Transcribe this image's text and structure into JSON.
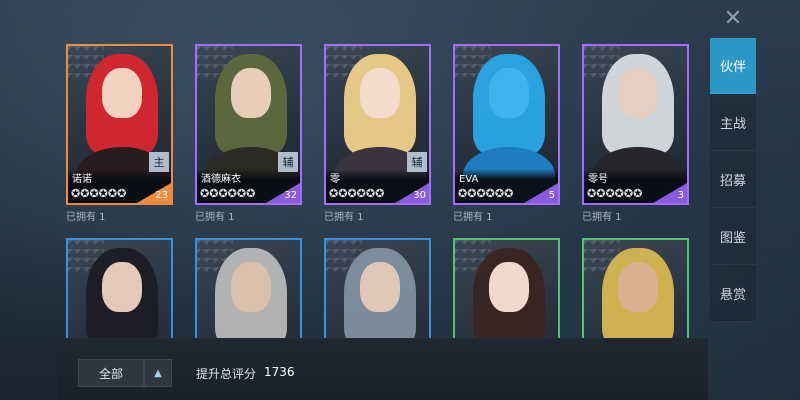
{
  "close_icon": "✕",
  "menu": [
    {
      "label": "伙伴",
      "active": true
    },
    {
      "label": "主战",
      "active": false
    },
    {
      "label": "招募",
      "active": false
    },
    {
      "label": "图鉴",
      "active": false
    },
    {
      "label": "悬赏",
      "active": false
    }
  ],
  "cards": [
    {
      "name": "诺诺",
      "level": "23",
      "role": "主",
      "owned": "已拥有  1",
      "stars": 6,
      "frame": "orange",
      "hair": "#d8262e",
      "skin": "#f3d2c0",
      "outfit": "#2a1b1e"
    },
    {
      "name": "酒德麻衣",
      "level": "32",
      "role": "辅",
      "owned": "已拥有  1",
      "stars": 6,
      "frame": "purple",
      "hair": "#5e6a3c",
      "skin": "#e8cdb8",
      "outfit": "#2c2a24"
    },
    {
      "name": "零",
      "level": "30",
      "role": "辅",
      "owned": "已拥有  1",
      "stars": 6,
      "frame": "purple",
      "hair": "#f0d08a",
      "skin": "#f4dccd",
      "outfit": "#3a3440"
    },
    {
      "name": "EVA",
      "level": "5",
      "role": "",
      "owned": "已拥有  1",
      "stars": 6,
      "frame": "purple",
      "hair": "#2aa8e8",
      "skin": "#3fb4ec",
      "outfit": "#1e7cc0"
    },
    {
      "name": "零号",
      "level": "3",
      "role": "",
      "owned": "已拥有  1",
      "stars": 6,
      "frame": "purple",
      "hair": "#d8dde2",
      "skin": "#e6d0c4",
      "outfit": "#26262a"
    },
    {
      "name": "",
      "level": "",
      "role": "",
      "owned": "",
      "stars": 0,
      "frame": "blue",
      "hair": "#1c1c26",
      "skin": "#e4c8b8",
      "outfit": "#3a3436"
    },
    {
      "name": "",
      "level": "",
      "role": "",
      "owned": "",
      "stars": 0,
      "frame": "blue",
      "hair": "#b8b8b8",
      "skin": "#d8c0aa",
      "outfit": "#4a5236"
    },
    {
      "name": "",
      "level": "",
      "role": "",
      "owned": "",
      "stars": 0,
      "frame": "blue",
      "hair": "#8090a0",
      "skin": "#e0c8b8",
      "outfit": "#3a3a3a"
    },
    {
      "name": "",
      "level": "",
      "role": "",
      "owned": "",
      "stars": 0,
      "frame": "green",
      "hair": "#3a2420",
      "skin": "#f0d8cc",
      "outfit": "#2a2030"
    },
    {
      "name": "",
      "level": "",
      "role": "",
      "owned": "",
      "stars": 0,
      "frame": "green",
      "hair": "#d8b850",
      "skin": "#d8b090",
      "outfit": "#2c4c9c"
    }
  ],
  "bottom": {
    "filter_label": "全部",
    "filter_toggle_icon": "▲",
    "score_label": "提升总评分",
    "score_value": "1736"
  },
  "star_glyph": "✪"
}
